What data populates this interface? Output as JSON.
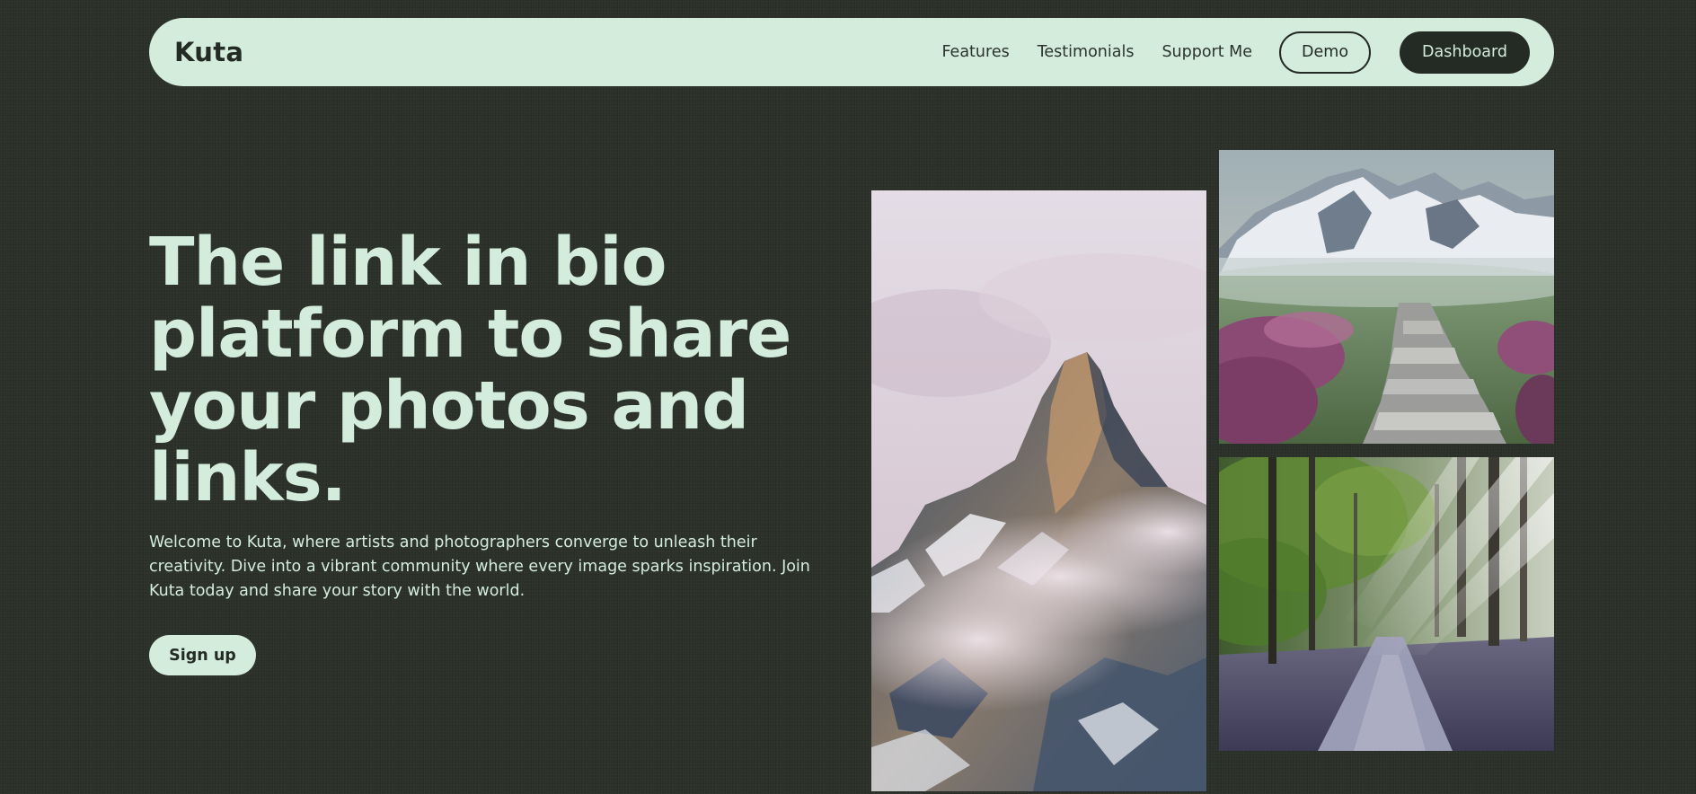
{
  "brand": "Kuta",
  "nav": {
    "links": [
      "Features",
      "Testimonials",
      "Support Me"
    ],
    "demo_label": "Demo",
    "dashboard_label": "Dashboard"
  },
  "hero": {
    "title": "The link in bio platform to share your photos and links.",
    "description": "Welcome to Kuta, where artists and photographers converge to unleash their creativity. Dive into a vibrant community where every image sparks inspiration. Join Kuta today and share your story with the world.",
    "signup_label": "Sign up"
  },
  "gallery": [
    {
      "icon": "mountain-peak-photo"
    },
    {
      "icon": "mountain-trail-photo"
    },
    {
      "icon": "forest-path-photo"
    }
  ],
  "colors": {
    "background": "#2b3129",
    "accent": "#d4ecdb",
    "dark": "#232b24"
  }
}
